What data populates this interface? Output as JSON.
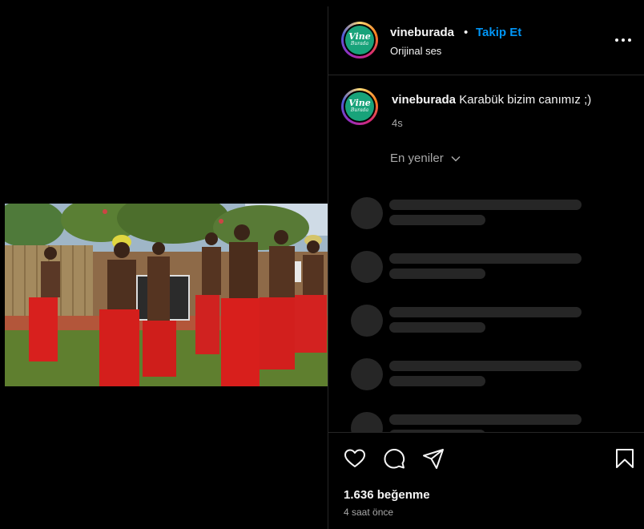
{
  "post": {
    "username": "vineburada",
    "separator": "•",
    "follow_label": "Takip Et",
    "audio_label": "Orijinal ses",
    "avatar_text_line1": "Vine",
    "avatar_text_line2": "Burada"
  },
  "caption": {
    "username": "vineburada",
    "text": " Karabük bizim canımız ;)",
    "time": "4s"
  },
  "comments": {
    "sort_label": "En yeniler",
    "loading_placeholders": 5
  },
  "footer": {
    "likes": "1.636 beğenme",
    "time": "4 saat önce"
  },
  "icons": {
    "more": "more-options-icon",
    "like": "heart-icon",
    "comment": "comment-icon",
    "share": "share-icon",
    "save": "bookmark-icon",
    "sort": "chevron-down-icon"
  },
  "colors": {
    "follow": "#0095f6",
    "secondary_text": "#a8a8a8",
    "skeleton": "#262626",
    "background": "#000000"
  }
}
